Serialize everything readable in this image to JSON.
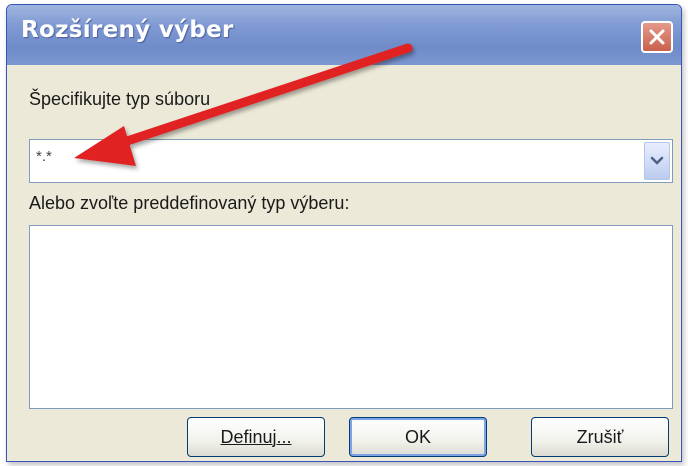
{
  "dialog": {
    "title": "Rozšírený výber",
    "file_type_label": "Špecifikujte typ súboru",
    "file_type_value": "*.*",
    "predefined_label": "Alebo zvoľte preddefinovaný typ výberu:",
    "predefined_items": []
  },
  "buttons": {
    "define": "Definuj...",
    "ok": "OK",
    "cancel": "Zrušiť"
  },
  "colors": {
    "annotation_arrow": "#e02020",
    "titlebar": "#7f9ad3",
    "close_button": "#c9604c"
  },
  "icons": {
    "close": "close-icon",
    "dropdown": "chevron-down-icon"
  }
}
